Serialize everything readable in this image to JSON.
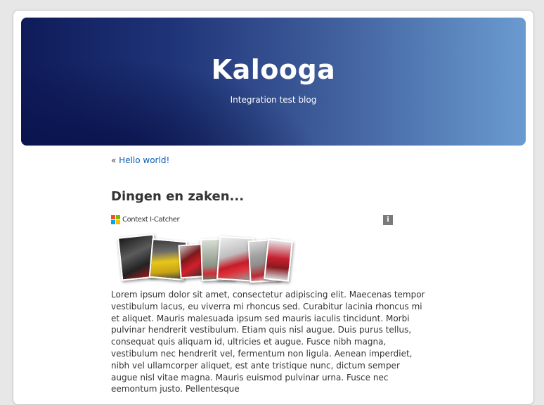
{
  "header": {
    "title": "Kalooga",
    "description": "Integration test blog"
  },
  "nav": {
    "prefix": "«",
    "prev_link": "Hello world!"
  },
  "post": {
    "title": "Dingen en zaken...",
    "widget": {
      "label": "Context I-Catcher",
      "info_icon": "i",
      "logo_colors": [
        "#f25022",
        "#7fba00",
        "#00a4ef",
        "#ffb900"
      ],
      "photo_colors": [
        "#2a2a2a",
        "#e6c31a",
        "#8b1a1a",
        "#a8b4a0",
        "#c91f2b",
        "#d8d8d8",
        "#b82230"
      ]
    },
    "body": "Lorem ipsum dolor sit amet, consectetur adipiscing elit. Maecenas tempor vestibulum lacus, eu viverra mi rhoncus sed. Curabitur lacinia rhoncus mi et aliquet. Mauris malesuada ipsum sed mauris iaculis tincidunt. Morbi pulvinar hendrerit vestibulum. Etiam quis nisl augue. Duis purus tellus, consequat quis aliquam id, ultricies et augue. Fusce nibh magna, vestibulum nec hendrerit vel, fermentum non ligula. Aenean imperdiet, nibh vel ullamcorper aliquet, est ante tristique nunc, dictum semper augue nisl vitae magna. Mauris euismod pulvinar urna. Fusce nec eemontum justo. Pellentesque"
  }
}
